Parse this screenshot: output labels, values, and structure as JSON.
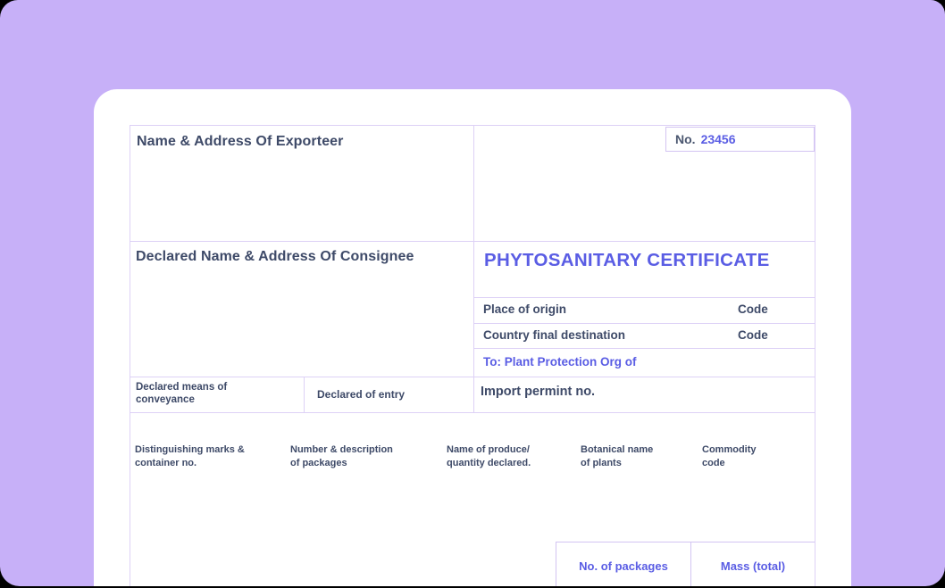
{
  "colors": {
    "background": "#000000",
    "panel": "#c7b0f8",
    "card": "#ffffff",
    "grid_border": "#ddd1f6",
    "accent": "#5a5de4",
    "text": "#3e4a68"
  },
  "certificate": {
    "no": {
      "label": "No.",
      "value": "23456"
    },
    "exporter_label": "Name & Address Of Exporteer",
    "consignee_label": "Declared Name & Address Of Consignee",
    "title": "PHYTOSANITARY CERTIFICATE",
    "origin": {
      "label": "Place of origin",
      "code_label": "Code"
    },
    "destination": {
      "label": "Country final destination",
      "code_label": "Code"
    },
    "to_line": "To: Plant Protection Org of",
    "conveyance_label": "Declared means of\nconveyance",
    "entry_label": "Declared of entry",
    "import_permit_label": "Import permint no.",
    "goods_columns": [
      "Distinguishing marks &\ncontainer no.",
      "Number & description\nof packages",
      "Name of produce/\nquantity declared.",
      "Botanical name\nof plants",
      "Commodity\ncode"
    ],
    "totals": {
      "packages_label": "No. of packages",
      "mass_label": "Mass (total)"
    }
  }
}
